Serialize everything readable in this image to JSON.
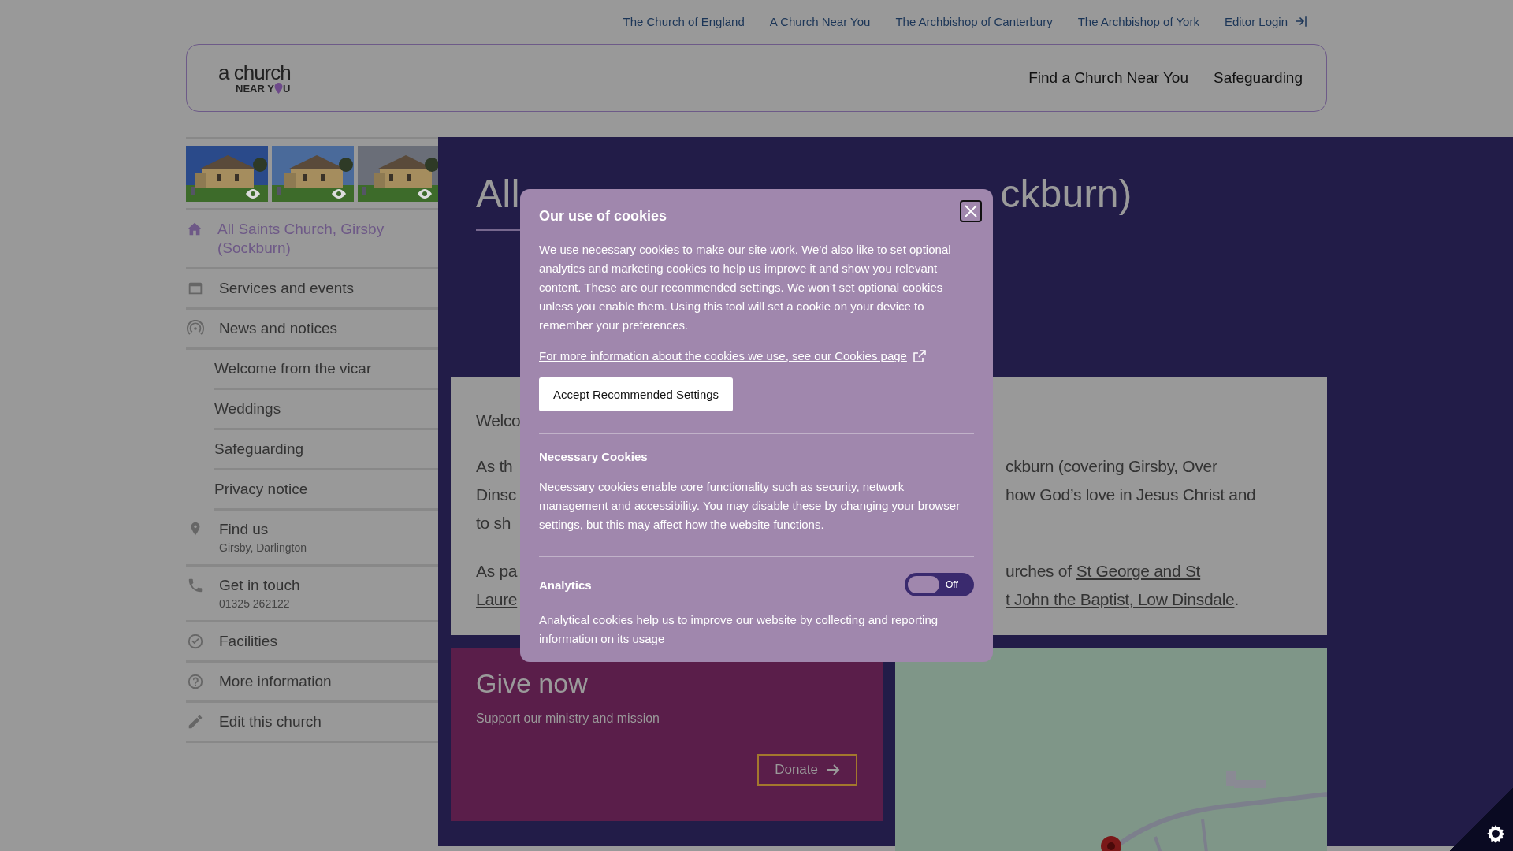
{
  "top_links": [
    "The Church of England",
    "A Church Near You",
    "The Archbishop of Canterbury",
    "The Archbishop of York",
    "Editor Login"
  ],
  "header": {
    "logo_top": "a church",
    "logo_bottom_1": "NEAR Y",
    "logo_bottom_2": "U",
    "nav": [
      "Find a Church Near You",
      "Safeguarding"
    ]
  },
  "sidebar": [
    {
      "label": "All Saints Church, Girsby (Sockburn)",
      "selected": true
    },
    {
      "label": "Services and events",
      "selected": false
    },
    {
      "label": "News and notices",
      "selected": false,
      "children": [
        {
          "label": "Welcome from the vicar",
          "selected": false
        },
        {
          "label": "Weddings",
          "selected": false
        },
        {
          "label": "Safeguarding",
          "selected": false
        },
        {
          "label": "Privacy notice",
          "selected": false
        }
      ]
    },
    {
      "label": "Find us",
      "sub": "Girsby, Darlington",
      "selected": false
    },
    {
      "label": "Get in touch",
      "sub": "01325 262122",
      "selected": false
    },
    {
      "label": "Facilities",
      "selected": false
    },
    {
      "label": "More information",
      "selected": false
    },
    {
      "label": "Edit this church",
      "selected": false
    }
  ],
  "title": {
    "left": "All",
    "right": "ckburn)"
  },
  "welcome": {
    "rows": [
      {
        "left": "Welco"
      },
      {
        "left": "As th",
        "right": "ckburn (covering Girsby, Over"
      },
      {
        "left": "Dinsc",
        "right": "how God’s love in Jesus Christ and"
      },
      {
        "left": "to sh"
      },
      {
        "left": "As pa",
        "right": "urches of",
        "right_link": "St George and St"
      },
      {
        "left_link": "Laure",
        "right_link": "t John the Baptist, Low Dinsdale",
        "right_after": "."
      }
    ]
  },
  "give": {
    "title": "Give now",
    "text": "Support our ministry and mission",
    "button": "Donate"
  },
  "cookies": {
    "title": "Our use of cookies",
    "intro": "We use necessary cookies to make our site work. We'd also like to set optional analytics and marketing cookies to help us improve it and show you relevant content. These are our recommended settings. We won’t set optional cookies unless you enable them. Using this tool will set a cookie on your device to remember your preferences.",
    "link": "For more information about the cookies we use, see our Cookies page",
    "accept": "Accept Recommended Settings",
    "sections": [
      {
        "kind": "plain",
        "title": "Necessary Cookies",
        "text": "Necessary cookies enable core functionality such as security, network management and accessibility. You may disable these by changing your browser settings, but this may affect how the website functions."
      },
      {
        "kind": "toggle",
        "title": "Analytics",
        "on": false,
        "state_label": "Off",
        "text": "Analytical cookies help us to improve our website by collecting and reporting information on its usage"
      }
    ]
  }
}
